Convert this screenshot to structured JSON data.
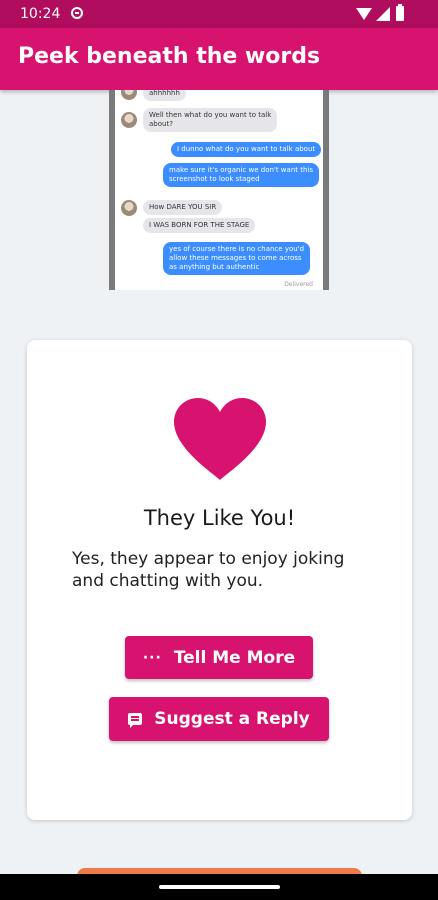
{
  "status_bar": {
    "time": "10:24"
  },
  "app_bar": {
    "title": "Peek beneath the words"
  },
  "screenshot": {
    "messages": [
      {
        "dir": "in",
        "text": "ahhhhhh"
      },
      {
        "dir": "in",
        "text": "Well then what do you want to talk\nabout?"
      },
      {
        "dir": "out",
        "text": "I dunno what do you want to talk about"
      },
      {
        "dir": "out",
        "text": "make sure it's organic we don't want this\nscreenshot to look staged"
      },
      {
        "dir": "in",
        "text": "How DARE YOU SIR"
      },
      {
        "dir": "in",
        "text": "I WAS BORN FOR THE STAGE"
      },
      {
        "dir": "out",
        "text": "yes of course there is no chance you'd\nallow these messages to come across\nas anything but authentic"
      }
    ],
    "delivered": "Delivered"
  },
  "result_card": {
    "icon": "heart-icon",
    "title": "They Like You!",
    "body": "Yes, they appear to enjoy joking and chatting with you.",
    "tell_more_label": "Tell Me More",
    "suggest_reply_label": "Suggest a Reply"
  },
  "colors": {
    "primary": "#d8126f",
    "status_bar": "#b00d5e",
    "background": "#eef2f5"
  }
}
